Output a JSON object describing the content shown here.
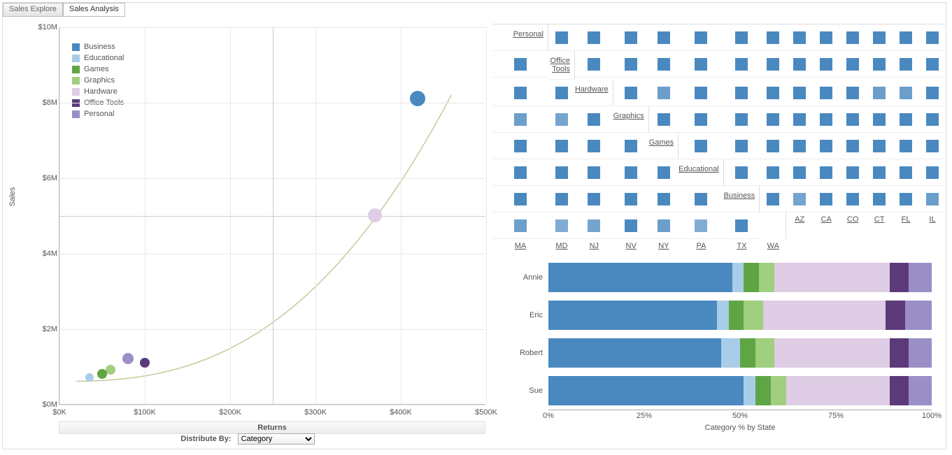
{
  "tabs": {
    "explore": "Sales Explore",
    "analysis": "Sales Analysis"
  },
  "distribute": {
    "label": "Distribute By:",
    "value": "Category"
  },
  "colors": {
    "Business": "#4a89c0",
    "Educational": "#a9cde8",
    "Games": "#5fa544",
    "Graphics": "#a0cf80",
    "Hardware": "#decde4",
    "Office Tools": "#5c3a7a",
    "Personal": "#9b8fc7"
  },
  "chart_data": [
    {
      "type": "scatter",
      "title": "",
      "xlabel": "Returns",
      "ylabel": "Sales",
      "xlim": [
        0,
        500000
      ],
      "ylim": [
        0,
        10000000
      ],
      "x_ticks": [
        "$0K",
        "$100K",
        "$200K",
        "$300K",
        "$400K",
        "$500K"
      ],
      "y_ticks": [
        "$0M",
        "$2M",
        "$4M",
        "$6M",
        "$8M",
        "$10M"
      ],
      "reference_lines": {
        "x": 250000,
        "y": 5000000
      },
      "legend": [
        "Business",
        "Educational",
        "Games",
        "Graphics",
        "Hardware",
        "Office Tools",
        "Personal"
      ],
      "points": [
        {
          "category": "Business",
          "returns": 420000,
          "sales": 8100000,
          "size": 22
        },
        {
          "category": "Hardware",
          "returns": 370000,
          "sales": 5000000,
          "size": 20
        },
        {
          "category": "Office Tools",
          "returns": 100000,
          "sales": 1100000,
          "size": 14
        },
        {
          "category": "Personal",
          "returns": 80000,
          "sales": 1200000,
          "size": 16
        },
        {
          "category": "Graphics",
          "returns": 60000,
          "sales": 900000,
          "size": 14
        },
        {
          "category": "Games",
          "returns": 50000,
          "sales": 800000,
          "size": 14
        },
        {
          "category": "Educational",
          "returns": 35000,
          "sales": 700000,
          "size": 12
        }
      ],
      "trend": true
    },
    {
      "type": "heatmap",
      "rows": [
        "Personal",
        "Office Tools",
        "Hardware",
        "Graphics",
        "Games",
        "Educational",
        "Business"
      ],
      "cols": [
        "AZ",
        "CA",
        "CO",
        "CT",
        "FL",
        "IL",
        "MA",
        "MD",
        "NJ",
        "NV",
        "NY",
        "PA",
        "TX",
        "WA"
      ],
      "intensity": {
        "Hardware": {
          "CA": 0.7,
          "NJ": 0.7,
          "NV": 0.7,
          "PA": 0.7,
          "TX": 0.6
        },
        "Business": {
          "CA": 0.6,
          "MA": 0.7,
          "MD": 0.7,
          "NJ": 0.5,
          "NV": 0.6,
          "PA": 0.7,
          "TX": 0.5
        }
      }
    },
    {
      "type": "bar",
      "orientation": "horizontal-stacked",
      "xlabel": "Category % by State",
      "xlim": [
        0,
        100
      ],
      "x_ticks": [
        "0%",
        "25%",
        "50%",
        "75%",
        "100%"
      ],
      "categories": [
        "Annie",
        "Eric",
        "Robert",
        "Sue"
      ],
      "series_order": [
        "Business",
        "Educational",
        "Games",
        "Graphics",
        "Hardware",
        "Office Tools",
        "Personal"
      ],
      "data": {
        "Annie": {
          "Business": 48,
          "Educational": 3,
          "Games": 4,
          "Graphics": 4,
          "Hardware": 30,
          "Office Tools": 5,
          "Personal": 6
        },
        "Eric": {
          "Business": 44,
          "Educational": 3,
          "Games": 4,
          "Graphics": 5,
          "Hardware": 32,
          "Office Tools": 5,
          "Personal": 7
        },
        "Robert": {
          "Business": 45,
          "Educational": 5,
          "Games": 4,
          "Graphics": 5,
          "Hardware": 30,
          "Office Tools": 5,
          "Personal": 6
        },
        "Sue": {
          "Business": 51,
          "Educational": 3,
          "Games": 4,
          "Graphics": 4,
          "Hardware": 27,
          "Office Tools": 5,
          "Personal": 6
        }
      }
    }
  ]
}
